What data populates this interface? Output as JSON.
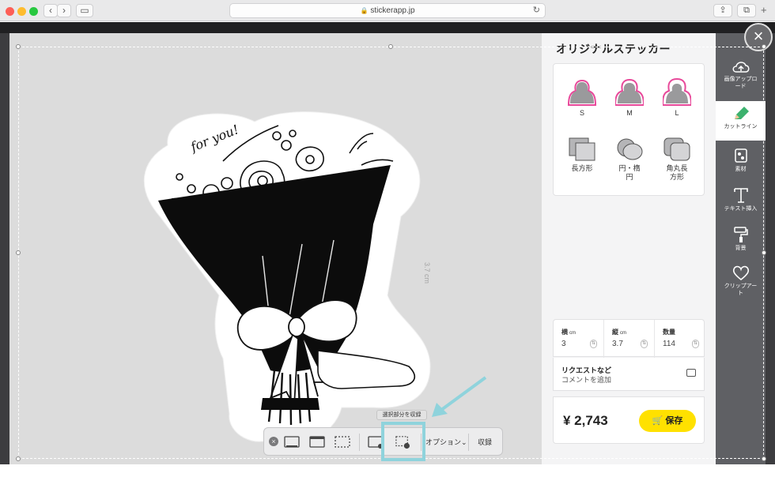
{
  "browser": {
    "url": "stickerapp.jp"
  },
  "panel": {
    "title": "オリジナルステッカー",
    "shape_options": [
      {
        "label": "S",
        "icon": "person-silhouette-icon"
      },
      {
        "label": "M",
        "icon": "person-silhouette-icon"
      },
      {
        "label": "L",
        "icon": "person-silhouette-icon"
      },
      {
        "label": "長方形",
        "icon": "rectangle-shape-icon"
      },
      {
        "label": "円・楕\n円",
        "icon": "circle-shape-icon"
      },
      {
        "label": "角丸長\n方形",
        "icon": "rounded-rectangle-shape-icon"
      }
    ],
    "dimensions": {
      "width_label": "横",
      "width_unit": "cm",
      "width_value": "3",
      "height_label": "縦",
      "height_unit": "cm",
      "height_value": "3.7",
      "quantity_label": "数量",
      "quantity_value": "114"
    },
    "request": {
      "title": "リクエストなど",
      "subtitle": "コメントを追加"
    },
    "price": "¥ 2,743",
    "save_label": "保存"
  },
  "canvas": {
    "size_label": "3.7 cm",
    "sticker_text": "for you!"
  },
  "sidebar": {
    "items": [
      {
        "label": "画像アップロ\nード",
        "icon": "cloud-upload-icon"
      },
      {
        "label": "カットライン",
        "icon": "pencil-icon",
        "active": true
      },
      {
        "label": "素材",
        "icon": "materials-icon"
      },
      {
        "label": "テキスト挿入",
        "icon": "text-icon"
      },
      {
        "label": "背景",
        "icon": "paint-roller-icon"
      },
      {
        "label": "クリップアー\nト",
        "icon": "heart-icon"
      }
    ]
  },
  "capture_toolbar": {
    "tooltip": "選択部分を収録",
    "options_label": "オプション⌄",
    "record_label": "収録"
  },
  "colors": {
    "accent_yellow": "#ffe100",
    "highlight_cyan": "#8fd3dc",
    "sidebar_bg": "#5f6064",
    "pencil_green": "#3cb26e",
    "silhouette_pink": "#e8499a"
  }
}
